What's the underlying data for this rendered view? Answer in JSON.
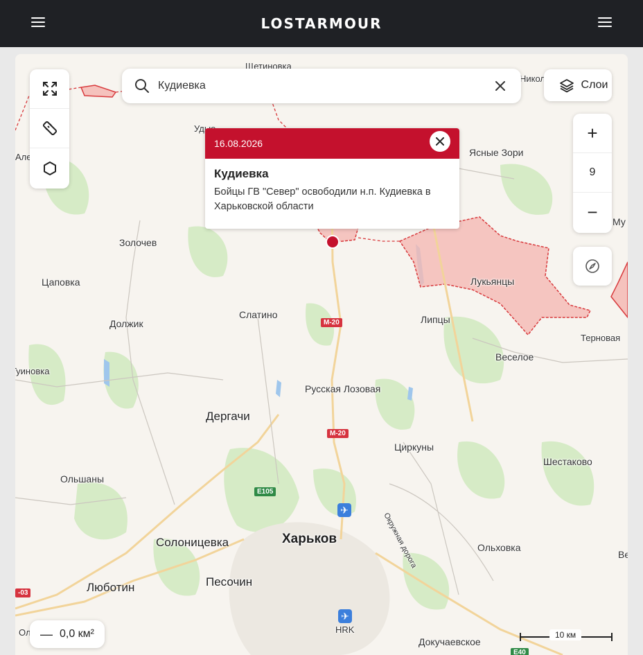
{
  "header": {
    "logo": "LOSTARMOUR"
  },
  "search": {
    "value": "Кудиевка"
  },
  "layers": {
    "label": "Слои"
  },
  "zoom": {
    "level": "9"
  },
  "area": {
    "value": "0,0 км²"
  },
  "popup": {
    "date": "16.08.2026",
    "title": "Кудиевка",
    "text": "Бойцы ГВ \"Север\" освободили н.п. Кудиевка в Харьковской области"
  },
  "scale": {
    "label": "10 км"
  },
  "colors": {
    "accent": "#c4112d",
    "occupied_fill": "#f4b9b4",
    "occupied_border": "#d8393c",
    "header_bg": "#1f2125"
  },
  "map": {
    "places": [
      "Щетиновка",
      "Николаевка",
      "Удые",
      "Алексеевка",
      "Ясные Зори",
      "Золочев",
      "Му",
      "Цаповка",
      "Лукьянцы",
      "Слатино",
      "Липцы",
      "Должик",
      "Терновая",
      "Веселое",
      "Гуиновка",
      "Русская Лозовая",
      "Дергачи",
      "Циркуны",
      "Шестаково",
      "Ольшаны",
      "Окружная дорога",
      "Солоницевка",
      "Харьков",
      "Ольховка",
      "Ве",
      "Люботин",
      "Песочин",
      "Докучаевское",
      "HRK",
      "Ол"
    ],
    "routes": [
      "M-20",
      "M-20",
      "E105",
      "-03",
      "E40"
    ]
  }
}
